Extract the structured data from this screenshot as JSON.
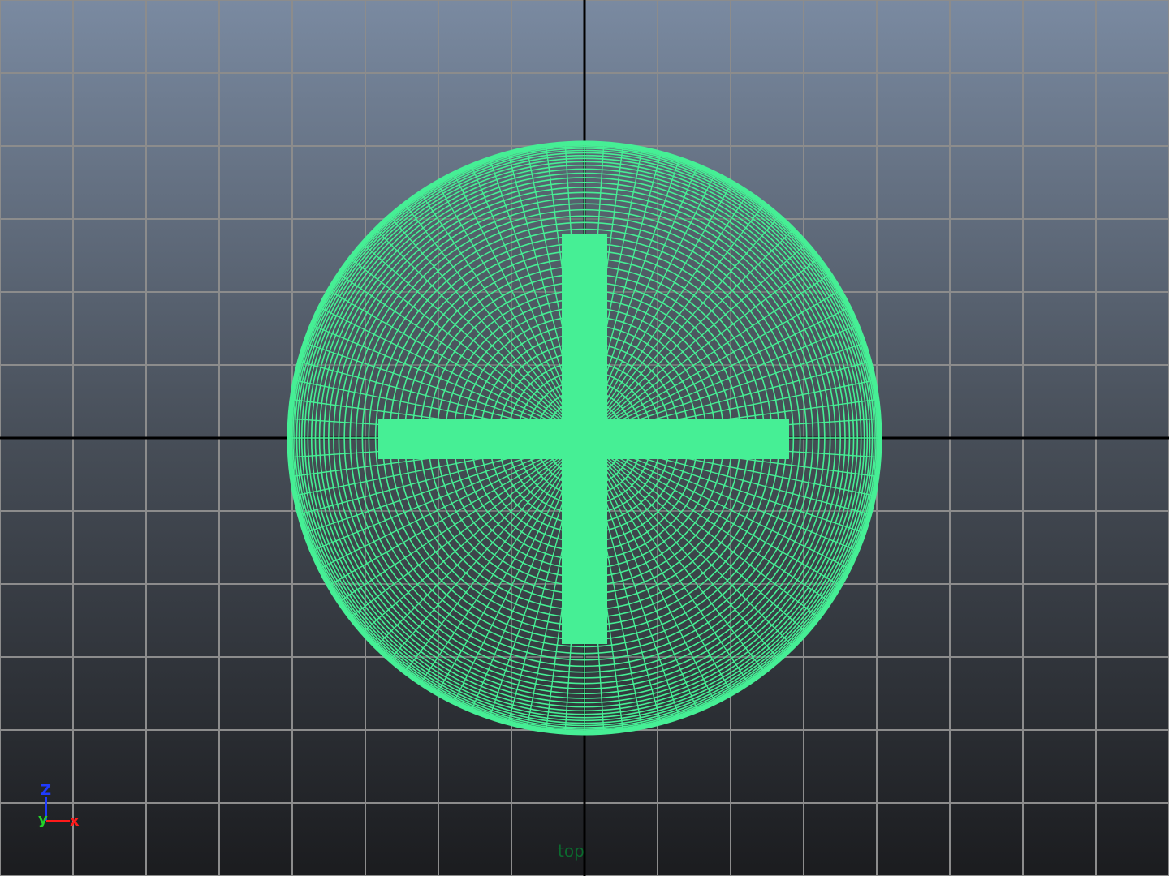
{
  "viewport": {
    "camera_name": "top",
    "background_top": "#7a8aa1",
    "background_bottom": "#1b1c1f",
    "grid_color": "#8c8c8c",
    "axis_line_color": "#000000",
    "wireframe_color": "#46ef95"
  },
  "gizmo": {
    "z_label": "Z",
    "y_label": "y",
    "x_label": "x",
    "z_color": "#1f3bff",
    "y_color": "#24d12a",
    "x_color": "#ff1a1a"
  }
}
